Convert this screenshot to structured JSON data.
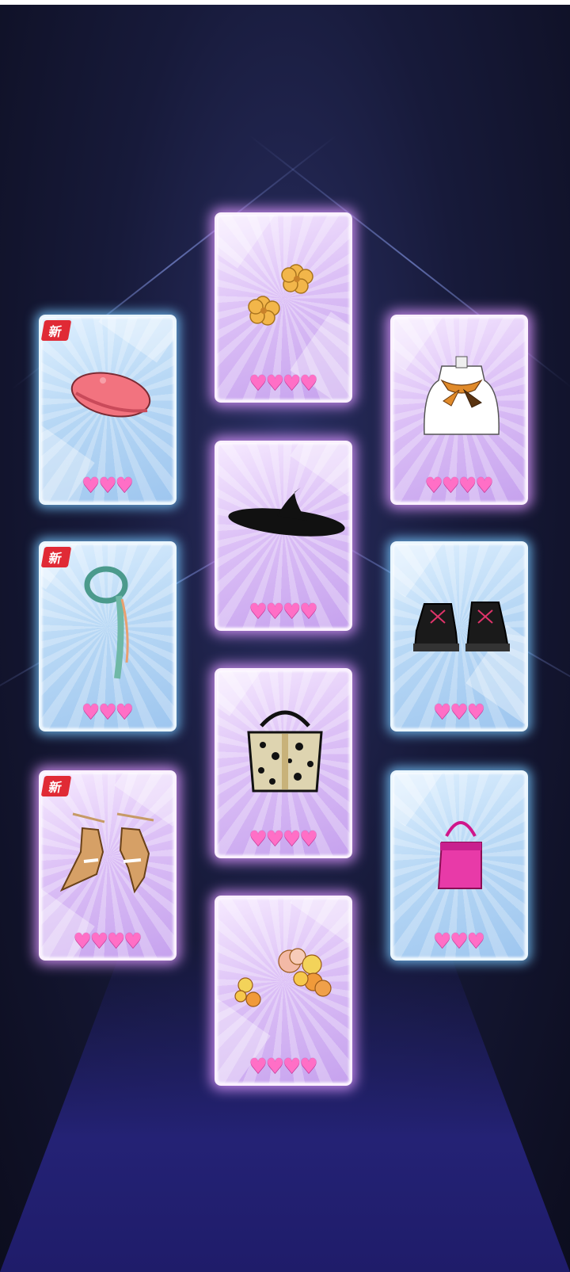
{
  "scene": "outfit-card-reveal",
  "colors": {
    "heart": "#ff6fc6",
    "new_badge": "#e02a35",
    "rare_card": "#b8d8f5",
    "epic_card": "#dcc0f6"
  },
  "cards": [
    {
      "id": "top-earrings",
      "item": "flower-earrings",
      "rarity": "purple",
      "hearts": 4,
      "is_new": false,
      "badge": ""
    },
    {
      "id": "beret",
      "item": "pink-beret",
      "rarity": "blue",
      "hearts": 3,
      "is_new": true,
      "badge": "新"
    },
    {
      "id": "scarf-bust",
      "item": "silk-scarf-bust",
      "rarity": "purple",
      "hearts": 4,
      "is_new": false,
      "badge": ""
    },
    {
      "id": "witch-hat",
      "item": "black-witch-hat",
      "rarity": "purple",
      "hearts": 4,
      "is_new": false,
      "badge": ""
    },
    {
      "id": "ribbon-scarf",
      "item": "green-ribbon-scarf",
      "rarity": "blue",
      "hearts": 3,
      "is_new": true,
      "badge": "新"
    },
    {
      "id": "boots",
      "item": "black-platform-boots",
      "rarity": "blue",
      "hearts": 3,
      "is_new": false,
      "badge": ""
    },
    {
      "id": "leopard-bag",
      "item": "leopard-handbag",
      "rarity": "purple",
      "hearts": 4,
      "is_new": false,
      "badge": ""
    },
    {
      "id": "lace-heels",
      "item": "lace-up-heels",
      "rarity": "purple",
      "hearts": 4,
      "is_new": true,
      "badge": "新"
    },
    {
      "id": "pink-bag",
      "item": "pink-mini-bag",
      "rarity": "blue",
      "hearts": 3,
      "is_new": false,
      "badge": ""
    },
    {
      "id": "flower-hairpins",
      "item": "flower-hairpins",
      "rarity": "purple",
      "hearts": 4,
      "is_new": false,
      "badge": ""
    }
  ],
  "heart_glyph": "♥"
}
